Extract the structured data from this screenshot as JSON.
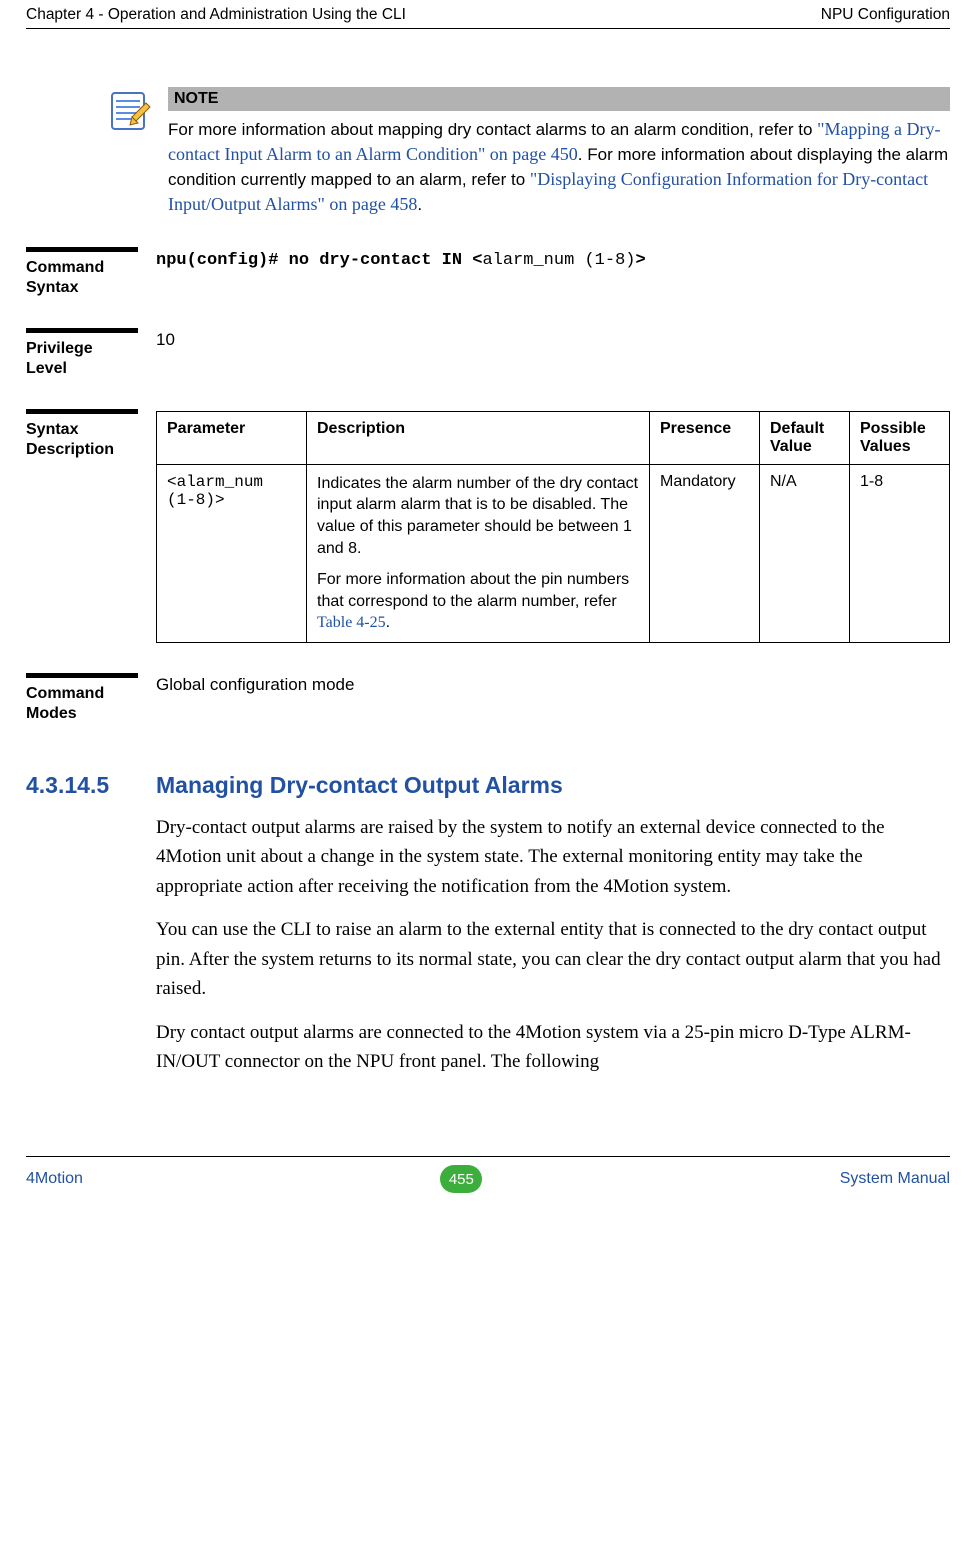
{
  "header": {
    "left": "Chapter 4 - Operation and Administration Using the CLI",
    "right": "NPU Configuration"
  },
  "note": {
    "title": "NOTE",
    "text_parts": {
      "p1": "For more information about mapping dry contact alarms to an alarm condition, refer to ",
      "xref1": "\"Mapping a Dry-contact Input Alarm to an Alarm Condition\" on page 450",
      "p2": ". For more information about displaying the alarm condition currently mapped to an alarm, refer to ",
      "xref2": "\"Displaying Configuration Information for Dry-contact Input/Output Alarms\" on page 458",
      "p3": "."
    }
  },
  "defs": {
    "command_syntax": {
      "label1": "Command",
      "label2": "Syntax",
      "value_bold1": "npu(config)# no dry-contact IN <",
      "value_param": "alarm_num (1-8)",
      "value_bold2": ">"
    },
    "privilege_level": {
      "label1": "Privilege",
      "label2": "Level",
      "value": "10"
    },
    "syntax_description": {
      "label1": "Syntax",
      "label2": "Description",
      "headers": {
        "param": "Parameter",
        "desc": "Description",
        "presence": "Presence",
        "default": "Default Value",
        "possible": "Possible Values"
      },
      "row": {
        "param": "<alarm_num (1-8)>",
        "desc_p1": "Indicates the alarm number of the dry contact input alarm alarm that is to be disabled. The value of this parameter should be between 1 and 8.",
        "desc_p2a": "For more information about the pin numbers that correspond to the alarm number, refer ",
        "desc_xref": "Table 4-25",
        "desc_p2b": ".",
        "presence": "Mandatory",
        "default": "N/A",
        "possible": "1-8"
      }
    },
    "command_modes": {
      "label1": "Command",
      "label2": "Modes",
      "value": "Global configuration mode"
    }
  },
  "section": {
    "num": "4.3.14.5",
    "title": "Managing Dry-contact Output Alarms"
  },
  "body": {
    "p1": "Dry-contact output alarms are raised by the system to notify an external device connected to the 4Motion unit about a change in the system state. The external monitoring entity may take the appropriate action after receiving the notification from the 4Motion system.",
    "p2": "You can use the CLI to raise an alarm to the external entity that is connected to the dry contact output pin. After the system returns to its normal state, you can clear the dry contact output alarm that you had raised.",
    "p3": "Dry contact output alarms are connected to the 4Motion system via a 25-pin micro D-Type ALRM-IN/OUT connector on the NPU front panel. The following"
  },
  "footer": {
    "left": "4Motion",
    "page": "455",
    "right": " System Manual"
  },
  "chart_data": {
    "type": "table",
    "title": "Syntax Description",
    "columns": [
      "Parameter",
      "Description",
      "Presence",
      "Default Value",
      "Possible Values"
    ],
    "rows": [
      {
        "Parameter": "<alarm_num (1-8)>",
        "Description": "Indicates the alarm number of the dry contact input alarm alarm that is to be disabled. The value of this parameter should be between 1 and 8. For more information about the pin numbers that correspond to the alarm number, refer Table 4-25.",
        "Presence": "Mandatory",
        "Default Value": "N/A",
        "Possible Values": "1-8"
      }
    ]
  }
}
